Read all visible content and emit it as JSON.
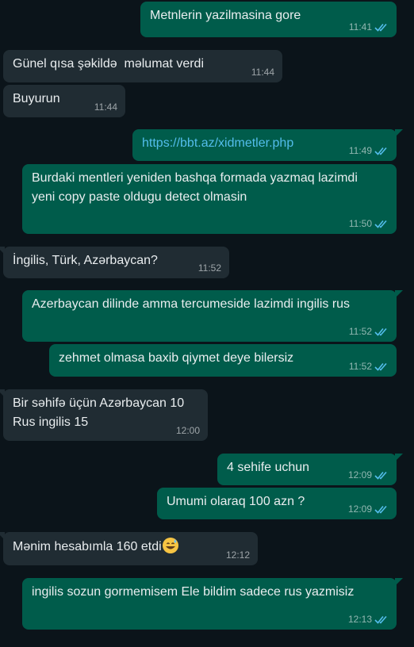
{
  "messages": [
    {
      "dir": "out",
      "text": "Metnlerin yazilmasina gore",
      "time": "11:41"
    },
    {
      "dir": "in",
      "text": "Günel qısa şəkildə  məlumat verdi",
      "time": "11:44"
    },
    {
      "dir": "in",
      "text": "Buyurun",
      "time": "11:44"
    },
    {
      "dir": "out",
      "text": "https://bbt.az/xidmetler.php",
      "time": "11:49"
    },
    {
      "dir": "out",
      "text": "Burdaki mentleri yeniden bashqa formada yazmaq lazimdi yeni copy paste oldugu detect olmasin",
      "time": "11:50"
    },
    {
      "dir": "in",
      "text": "İngilis, Türk, Azərbaycan?",
      "time": "11:52"
    },
    {
      "dir": "out",
      "text": "Azerbaycan dilinde amma tercumeside lazimdi ingilis rus",
      "time": "11:52"
    },
    {
      "dir": "out",
      "text": "zehmet olmasa baxib qiymet deye bilersiz",
      "time": "11:52"
    },
    {
      "dir": "in",
      "text": "Bir səhifə üçün Azərbaycan 10\nRus ingilis 15",
      "time": "12:00"
    },
    {
      "dir": "out",
      "text": "4 sehife uchun",
      "time": "12:09"
    },
    {
      "dir": "out",
      "text": "Umumi olaraq 100 azn ?",
      "time": "12:09"
    },
    {
      "dir": "in",
      "text": "Mənim hesabımla 160 etdi",
      "time": "12:12"
    },
    {
      "dir": "out",
      "text": "ingilis sozun gormemisem Ele bildim sadece rus yazmisiz",
      "time": "12:13"
    }
  ],
  "colors": {
    "incoming": "#202c33",
    "outgoing": "#005c4b",
    "read_ticks": "#53bdeb",
    "link": "#53bdeb"
  },
  "icons": {
    "read_receipt": "double-check-icon",
    "emoji": "grinning-sweat-emoji-icon"
  }
}
